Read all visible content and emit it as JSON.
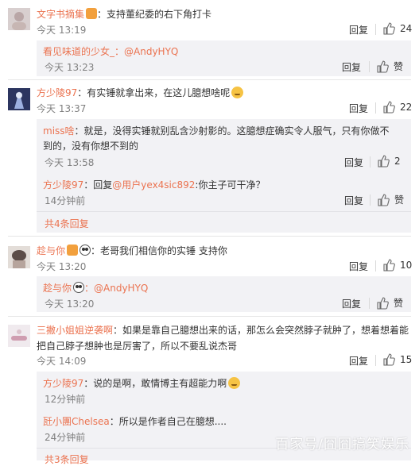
{
  "labels": {
    "reply": "回复",
    "like": "赞"
  },
  "comments": [
    {
      "user": "文字书摘集",
      "text": "：支持董纪委的右下角打卡",
      "time": "今天 13:19",
      "likes": "24",
      "replies": [
        {
          "user": "看见味道的少女_",
          "text": "：@AndyHYQ",
          "time": "今天 13:23"
        }
      ]
    },
    {
      "user": "方少陵97",
      "text": "：有实锤就拿出来，在这儿臆想啥呢",
      "time": "今天 13:37",
      "likes": "22",
      "replies": [
        {
          "user": "miss啥",
          "line1": "：就是，没得实锤就别乱含沙射影的。这臆想症确实令人服气，只有你做不",
          "line2": "到的，没有你想不到的",
          "time": "今天 13:58",
          "likes": "2"
        },
        {
          "user": "方少陵97",
          "prefix": "：回复",
          "mention": "@用户yex4sic892",
          "text": ":你主子可干净？",
          "time": "14分钟前"
        }
      ],
      "total": "共4条回复"
    },
    {
      "user": "趁与你",
      "text": "：老哥我们相信你的实锤 支持你",
      "time": "今天 13:20",
      "likes": "10",
      "replies": [
        {
          "user": "趁与你",
          "text": "：@AndyHYQ",
          "time": "今天 13:20"
        }
      ]
    },
    {
      "user": "三撇小姐姐逆袭啊",
      "line1": "：如果是靠自己臆想出来的话，那怎么会突然脖子就肿了，想着想着能",
      "line2": "把自己脖子想肿也是厉害了，所以不要乱说杰哥",
      "time": "今天 14:09",
      "likes": "15",
      "replies": [
        {
          "user": "方少陵97",
          "text": "：说的是啊，敢情博主有超能力啊",
          "time": "12分钟前"
        },
        {
          "user": "瓩小團Chelsea",
          "text": "：所以是作者自己在臆想....",
          "time": "24分钟前"
        }
      ],
      "total": "共3条回复"
    }
  ],
  "watermark": "百家号/囧囧搞笑娱乐",
  "colors": {
    "accent": "#eb7350",
    "reply_bg": "#f2f2f5",
    "text": "#333333",
    "meta": "#808080"
  }
}
